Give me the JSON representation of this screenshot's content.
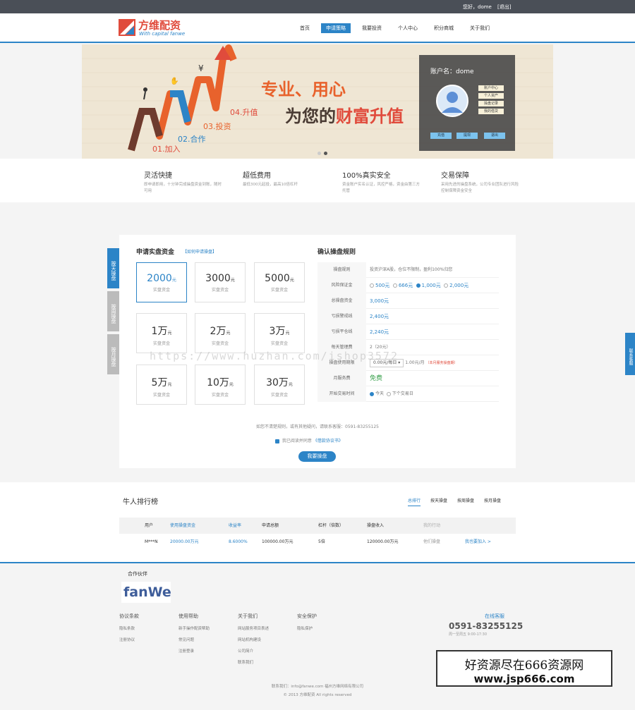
{
  "topbar": {
    "greeting": "您好，dome",
    "logout": "[退出]"
  },
  "brand": {
    "name_cn": "方维配资",
    "name_en": "With capital fanwe"
  },
  "nav": [
    {
      "label": "首页",
      "active": false
    },
    {
      "label": "申请策略",
      "active": true
    },
    {
      "label": "我要投资",
      "active": false
    },
    {
      "label": "个人中心",
      "active": false
    },
    {
      "label": "积分商城",
      "active": false
    },
    {
      "label": "关于我们",
      "active": false
    }
  ],
  "banner": {
    "slogan1": "专业、用心",
    "slogan2a": "为您的",
    "slogan2b": "财富升值",
    "steps": [
      "01.加入",
      "02.合作",
      "03.投资",
      "04.升值"
    ],
    "user": {
      "name": "账户名：dome",
      "links": [
        "账户中心",
        "个人资产",
        "操盘记录",
        "我的借贷"
      ],
      "buttons": [
        "充值",
        "提现",
        "退出"
      ]
    }
  },
  "features": [
    {
      "title": "灵活快捷",
      "desc": "即申请即用，十分钟完成操盘资金到账，随时可用"
    },
    {
      "title": "超低费用",
      "desc": "最低300元起投，最高10倍杠杆"
    },
    {
      "title": "100%真实安全",
      "desc": "资金账户实名认证，风控严格，资金由第三方托管"
    },
    {
      "title": "交易保障",
      "desc": "采用先进的操盘系统，公司专业团队进行风险控制保障资金安全"
    }
  ],
  "side_tabs": [
    "按天操盘",
    "按周操盘",
    "按月操盘"
  ],
  "apply": {
    "title": "申请实盘资金",
    "link": "【如何申请操盘】",
    "options": [
      {
        "amount": "2000",
        "unit": "元",
        "label": "实盘资金",
        "selected": true
      },
      {
        "amount": "3000",
        "unit": "元",
        "label": "实盘资金",
        "selected": false
      },
      {
        "amount": "5000",
        "unit": "元",
        "label": "实盘资金",
        "selected": false
      },
      {
        "amount": "1万",
        "unit": "元",
        "label": "实盘资金",
        "selected": false
      },
      {
        "amount": "2万",
        "unit": "元",
        "label": "实盘资金",
        "selected": false
      },
      {
        "amount": "3万",
        "unit": "元",
        "label": "实盘资金",
        "selected": false
      },
      {
        "amount": "5万",
        "unit": "元",
        "label": "实盘资金",
        "selected": false
      },
      {
        "amount": "10万",
        "unit": "元",
        "label": "实盘资金",
        "selected": false
      },
      {
        "amount": "30万",
        "unit": "元",
        "label": "实盘资金",
        "selected": false
      }
    ]
  },
  "rules": {
    "title": "确认操盘规则",
    "rows": [
      {
        "key": "操盘规则",
        "value": "投资沪深A股，仓位不限制，盈利100%归您"
      },
      {
        "key": "风险保证金",
        "value": ""
      },
      {
        "key": "总操盘资金",
        "value": "3,000元"
      },
      {
        "key": "亏损警戒线",
        "value": "2,400元"
      },
      {
        "key": "亏损平仓线",
        "value": "2,240元"
      },
      {
        "key": "每天管理费",
        "value": "2（20元）"
      },
      {
        "key": "操盘使用期限",
        "value": "1.00元/月"
      },
      {
        "key": "月服务费",
        "value": "免费"
      },
      {
        "key": "开始交易时间",
        "value": ""
      }
    ],
    "deposits": [
      "500元",
      "666元",
      "1,000元",
      "2,000元"
    ],
    "deposit_selected": 2,
    "term_select": "0.00元/每日 ▾",
    "term_note": "（本月服务操盘期）",
    "start_options": [
      "今天",
      "下个交易日"
    ]
  },
  "apply_footer": {
    "note": "如您不清楚规则，或有其他疑问，请联系客服：0591-83255125",
    "agree_text": "我已阅读并同意",
    "agree_link": "《借款协议书》",
    "button": "我要操盘"
  },
  "watermark": "https://www.huzhan.com/ishop3572",
  "ranking": {
    "title": "牛人排行榜",
    "tabs": [
      {
        "label": "总排行",
        "active": true
      },
      {
        "label": "按天操盘",
        "active": false
      },
      {
        "label": "按周操盘",
        "active": false
      },
      {
        "label": "按月操盘",
        "active": false
      }
    ],
    "headers": [
      "用户",
      "使用操盘资金",
      "收益率",
      "申请总额",
      "杠杆（倍数）",
      "操盘收入",
      "我的行动"
    ],
    "rows": [
      [
        "M***N",
        "20000.00万元",
        "8.6000%",
        "100000.00万元",
        "5倍",
        "120000.00万元",
        "他们操盘",
        "我也要加入 >"
      ]
    ]
  },
  "partner": {
    "title": "合作伙伴",
    "logo": "fanWe"
  },
  "footer": {
    "columns": [
      {
        "title": "协议条款",
        "items": [
          "隐私条款",
          "注册协议"
        ]
      },
      {
        "title": "使用帮助",
        "items": [
          "新手操作配资帮助",
          "常见问题",
          "注册登录"
        ]
      },
      {
        "title": "关于我们",
        "items": [
          "网站服务项目表述",
          "网站机构建设",
          "公司简介",
          "联系我们"
        ]
      },
      {
        "title": "安全保护",
        "items": [
          "隐私保护"
        ]
      }
    ],
    "hotline_label": "在线客服",
    "hotline": "0591-83255125",
    "hours": "周一至周五 9:00-17:30",
    "contact": "联系我们：info@fanwe.com  福州方维网络有限公司",
    "copyright": "© 2013 方维配资 All rights reserved"
  },
  "right_tab": "联系客服",
  "stamp": {
    "line1": "好资源尽在666资源网",
    "line2": "www.jsp666.com"
  },
  "colors": {
    "accent": "#2c84c7",
    "brand_red": "#e04b3c",
    "topbar": "#4a4f57"
  }
}
